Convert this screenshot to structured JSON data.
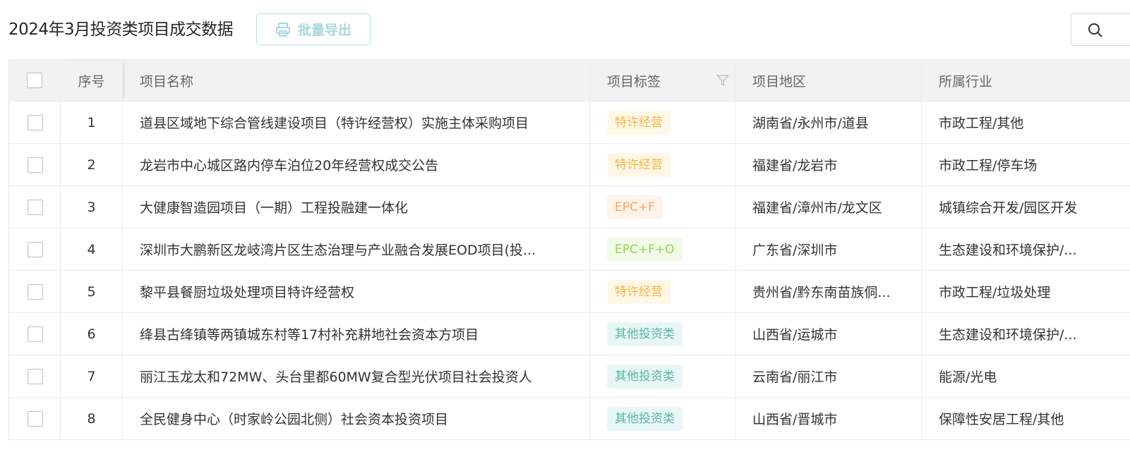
{
  "title": "2024年3月投资类项目成交数据",
  "toolbar": {
    "export_label": "批量导出"
  },
  "columns": {
    "index": "序号",
    "name": "项目名称",
    "tag": "项目标签",
    "region": "项目地区",
    "industry": "所属行业"
  },
  "tag_colors": {
    "特许经营": "#f3b64a",
    "EPC+F": "#f6a464",
    "EPC+F+O": "#9bd05a",
    "其他投资类": "#58b7a6"
  },
  "rows": [
    {
      "index": "1",
      "name": "道县区域地下综合管线建设项目（特许经营权）实施主体采购项目",
      "tag": "特许经营",
      "region": "湖南省/永州市/道县",
      "industry": "市政工程/其他"
    },
    {
      "index": "2",
      "name": "龙岩市中心城区路内停车泊位20年经营权成交公告",
      "tag": "特许经营",
      "region": "福建省/龙岩市",
      "industry": "市政工程/停车场"
    },
    {
      "index": "3",
      "name": "大健康智造园项目（一期）工程投融建一体化",
      "tag": "EPC+F",
      "region": "福建省/漳州市/龙文区",
      "industry": "城镇综合开发/园区开发"
    },
    {
      "index": "4",
      "name": "深圳市大鹏新区龙岐湾片区生态治理与产业融合发展EOD项目(投...",
      "tag": "EPC+F+O",
      "region": "广东省/深圳市",
      "industry": "生态建设和环境保护/..."
    },
    {
      "index": "5",
      "name": "黎平县餐厨垃圾处理项目特许经营权",
      "tag": "特许经营",
      "region": "贵州省/黔东南苗族侗...",
      "industry": "市政工程/垃圾处理"
    },
    {
      "index": "6",
      "name": "绛县古绛镇等两镇城东村等17村补充耕地社会资本方项目",
      "tag": "其他投资类",
      "region": "山西省/运城市",
      "industry": "生态建设和环境保护/..."
    },
    {
      "index": "7",
      "name": "丽江玉龙太和72MW、头台里都60MW复合型光伏项目社会投资人",
      "tag": "其他投资类",
      "region": "云南省/丽江市",
      "industry": "能源/光电"
    },
    {
      "index": "8",
      "name": "全民健身中心（时家岭公园北侧）社会资本投资项目",
      "tag": "其他投资类",
      "region": "山西省/晋城市",
      "industry": "保障性安居工程/其他"
    }
  ]
}
